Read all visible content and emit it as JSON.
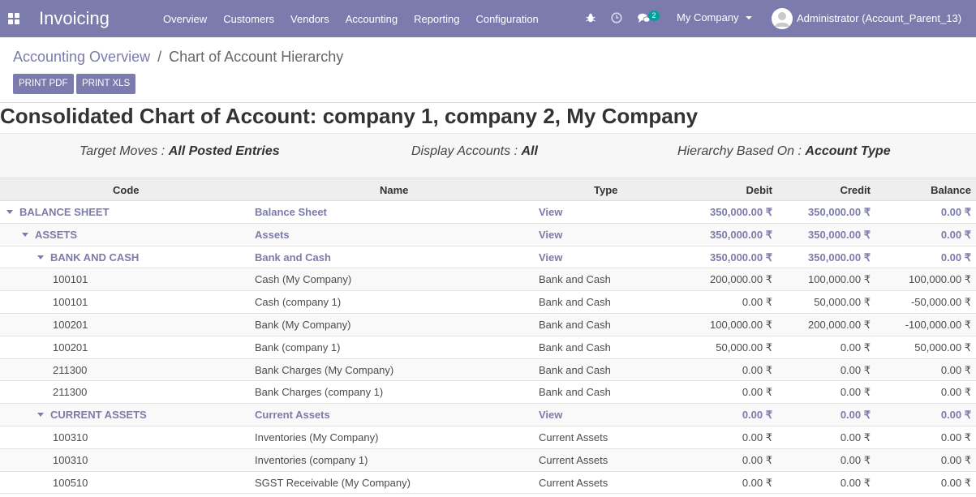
{
  "navbar": {
    "app_title": "Invoicing",
    "menu": [
      "Overview",
      "Customers",
      "Vendors",
      "Accounting",
      "Reporting",
      "Configuration"
    ],
    "chat_badge": "2",
    "company": "My Company",
    "user": "Administrator (Account_Parent_13)"
  },
  "breadcrumb": {
    "parent": "Accounting Overview",
    "separator": "/",
    "current": "Chart of Account Hierarchy"
  },
  "buttons": {
    "print_pdf": "PRINT PDF",
    "print_xls": "PRINT XLS"
  },
  "report": {
    "title": "Consolidated Chart of Account: company 1, company 2, My Company",
    "filters": {
      "target_moves_label": "Target Moves : ",
      "target_moves_value": "All Posted Entries",
      "display_accounts_label": "Display Accounts : ",
      "display_accounts_value": "All",
      "hierarchy_label": "Hierarchy Based On : ",
      "hierarchy_value": "Account Type"
    },
    "columns": {
      "code": "Code",
      "name": "Name",
      "type": "Type",
      "debit": "Debit",
      "credit": "Credit",
      "balance": "Balance"
    },
    "rows": [
      {
        "level": 0,
        "group": true,
        "code": "BALANCE SHEET",
        "name": "Balance Sheet",
        "type": "View",
        "debit": "350,000.00 ₹",
        "credit": "350,000.00 ₹",
        "balance": "0.00 ₹"
      },
      {
        "level": 1,
        "group": true,
        "code": "ASSETS",
        "name": "Assets",
        "type": "View",
        "debit": "350,000.00 ₹",
        "credit": "350,000.00 ₹",
        "balance": "0.00 ₹"
      },
      {
        "level": 2,
        "group": true,
        "code": "BANK AND CASH",
        "name": "Bank and Cash",
        "type": "View",
        "debit": "350,000.00 ₹",
        "credit": "350,000.00 ₹",
        "balance": "0.00 ₹"
      },
      {
        "level": 3,
        "group": false,
        "code": "100101",
        "name": "Cash (My Company)",
        "type": "Bank and Cash",
        "debit": "200,000.00 ₹",
        "credit": "100,000.00 ₹",
        "balance": "100,000.00 ₹"
      },
      {
        "level": 3,
        "group": false,
        "code": "100101",
        "name": "Cash (company 1)",
        "type": "Bank and Cash",
        "debit": "0.00 ₹",
        "credit": "50,000.00 ₹",
        "balance": "-50,000.00 ₹"
      },
      {
        "level": 3,
        "group": false,
        "code": "100201",
        "name": "Bank (My Company)",
        "type": "Bank and Cash",
        "debit": "100,000.00 ₹",
        "credit": "200,000.00 ₹",
        "balance": "-100,000.00 ₹"
      },
      {
        "level": 3,
        "group": false,
        "code": "100201",
        "name": "Bank (company 1)",
        "type": "Bank and Cash",
        "debit": "50,000.00 ₹",
        "credit": "0.00 ₹",
        "balance": "50,000.00 ₹"
      },
      {
        "level": 3,
        "group": false,
        "code": "211300",
        "name": "Bank Charges (My Company)",
        "type": "Bank and Cash",
        "debit": "0.00 ₹",
        "credit": "0.00 ₹",
        "balance": "0.00 ₹"
      },
      {
        "level": 3,
        "group": false,
        "code": "211300",
        "name": "Bank Charges (company 1)",
        "type": "Bank and Cash",
        "debit": "0.00 ₹",
        "credit": "0.00 ₹",
        "balance": "0.00 ₹"
      },
      {
        "level": 2,
        "group": true,
        "code": "CURRENT ASSETS",
        "name": "Current Assets",
        "type": "View",
        "debit": "0.00 ₹",
        "credit": "0.00 ₹",
        "balance": "0.00 ₹"
      },
      {
        "level": 3,
        "group": false,
        "code": "100310",
        "name": "Inventories (My Company)",
        "type": "Current Assets",
        "debit": "0.00 ₹",
        "credit": "0.00 ₹",
        "balance": "0.00 ₹"
      },
      {
        "level": 3,
        "group": false,
        "code": "100310",
        "name": "Inventories (company 1)",
        "type": "Current Assets",
        "debit": "0.00 ₹",
        "credit": "0.00 ₹",
        "balance": "0.00 ₹"
      },
      {
        "level": 3,
        "group": false,
        "code": "100510",
        "name": "SGST Receivable (My Company)",
        "type": "Current Assets",
        "debit": "0.00 ₹",
        "credit": "0.00 ₹",
        "balance": "0.00 ₹"
      }
    ]
  },
  "colors": {
    "brand": "#7c7bad",
    "badge": "#00a09d"
  }
}
